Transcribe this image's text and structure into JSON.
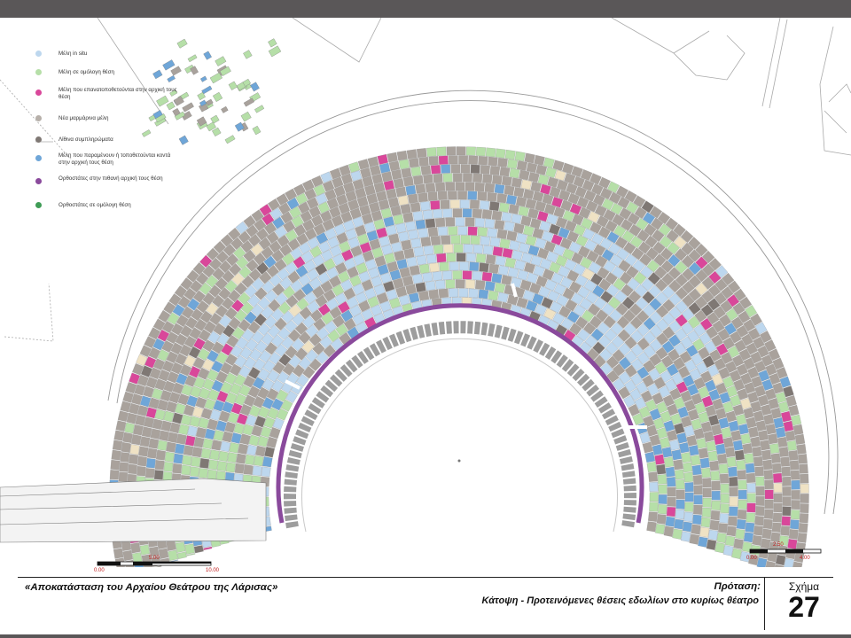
{
  "legend": [
    {
      "label": "Μέλη in situ",
      "color": "#bdd7ee"
    },
    {
      "label": "Μέλη σε ομόλογη θέση",
      "color": "#b6dfa8"
    },
    {
      "label": "Μέλη που επανατοποθετούνται στην αρχική τους θέση",
      "color": "#d9479a"
    },
    {
      "label": "Νέα μαρμάρινα μέλη",
      "color": "#b7b0aa"
    },
    {
      "label": "Λίθινα συμπληρώματα",
      "color": "#7f7874"
    },
    {
      "label": "Μέλη που παραμένουν ή τοποθετούνται κοντά στην αρχική τους θέση",
      "color": "#6fa6d8"
    },
    {
      "label": "Ορθοστάτες στην πιθανή αρχική τους θέση",
      "color": "#8a4a9c"
    },
    {
      "label": "Ορθοστάτες σε ομόλογη θέση",
      "color": "#3f9c56"
    }
  ],
  "scale_left": {
    "ticks": [
      "0.00",
      "5.00",
      "10.00"
    ]
  },
  "scale_right": {
    "ticks": [
      "0.00",
      "2.50",
      "4.00"
    ]
  },
  "title_block": {
    "project_title": "«Αποκατάσταση του Αρχαίου Θεάτρου της Λάρισας»",
    "proposal_label": "Πρόταση:",
    "sheet_description": "Κάτοψη - Προτεινόμενες θέσεις εδωλίων στο κυρίως θέατρο",
    "figure_label": "Σχήμα",
    "figure_number": "27"
  },
  "colors": {
    "in_situ": "#bdd7ee",
    "homologous": "#b6dfa8",
    "repositioned": "#d9479a",
    "new_marble": "#a9a29c",
    "stone_fill": "#7f7874",
    "near_original": "#6fa6d8",
    "orthostat_original": "#8a4a9c",
    "orthostat_homologous": "#3f9c56",
    "scale_red": "#c01a1a",
    "bar_dark": "#5a5758"
  }
}
